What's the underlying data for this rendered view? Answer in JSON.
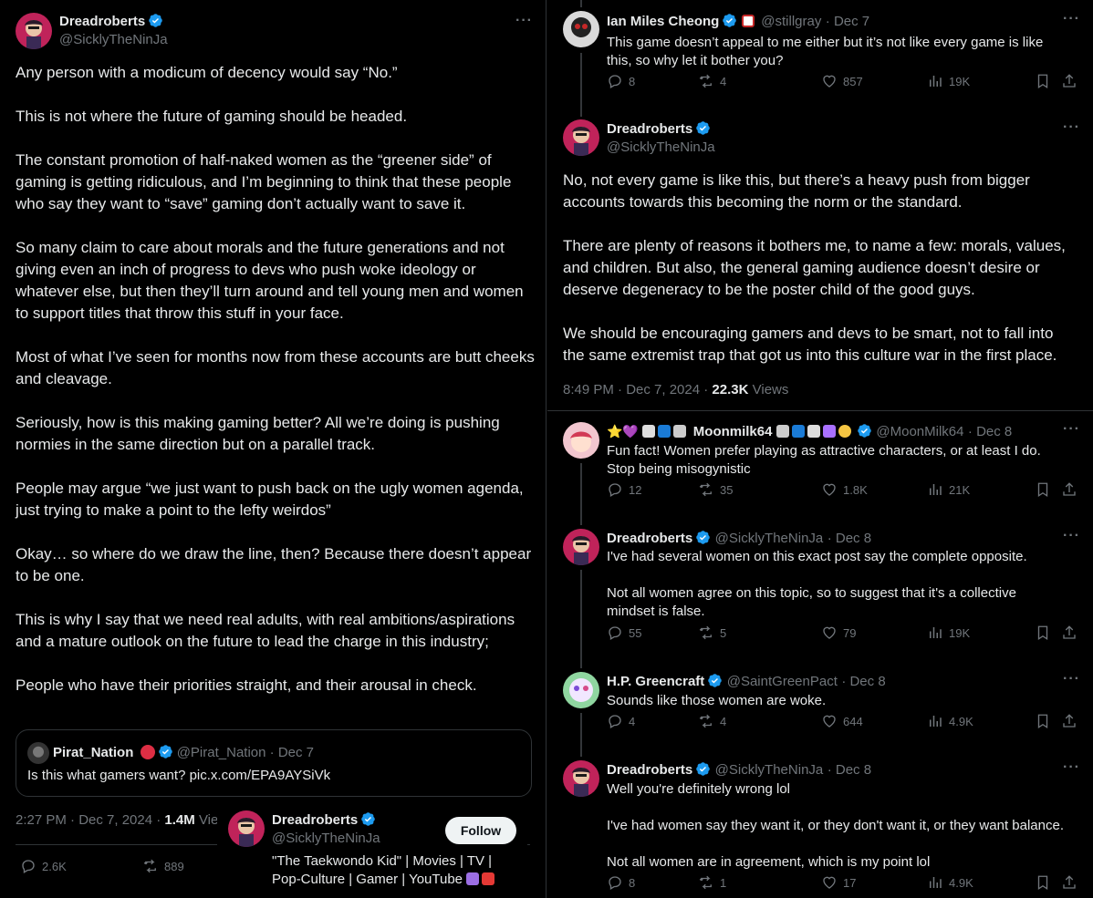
{
  "main_post": {
    "author_name": "Dreadroberts",
    "author_handle": "@SicklyTheNinJa",
    "paragraphs": [
      "Any person with a modicum of decency would say “No.”",
      "This is not where the future of gaming should be headed.",
      "The constant promotion of half-naked women as the “greener side” of gaming is getting ridiculous, and I’m beginning to think that these people who say they want to “save” gaming don’t actually want to save it.",
      "So many claim to care about morals and the future generations and not giving even an inch of progress to devs who push woke ideology or whatever else, but then they’ll turn around and tell young men and women to support titles that throw this stuff in your face.",
      "Most of what I’ve seen for months now from these accounts are butt cheeks and cleavage.",
      "Seriously, how is this making gaming better? All we’re doing is pushing normies in the same direction but on a parallel track.",
      "People may argue “we just want to push back on the ugly women agenda, just trying to make a point to the lefty weirdos”",
      "Okay… so where do we draw the line, then? Because there doesn’t appear to be one.",
      "This is why I say that we need real adults, with real ambitions/aspirations and a mature outlook on the future to lead the charge in this industry;",
      "People who have their priorities straight, and their arousal in check."
    ],
    "quote": {
      "name": "Pirat_Nation",
      "handle": "@Pirat_Nation",
      "date": "Dec 7",
      "text": "Is this what gamers want? pic.x.com/EPA9AYSiVk"
    },
    "timestamp": "2:27 PM · Dec 7, 2024 ·",
    "views_count": "1.4M",
    "views_label": "View",
    "replies": "2.6K",
    "reposts": "889"
  },
  "hovercard": {
    "name": "Dreadroberts",
    "handle": "@SicklyTheNinJa",
    "follow_label": "Follow",
    "bio_line1": "\"The Taekwondo Kid\" | Movies | TV |",
    "bio_line2": "Pop-Culture | Gamer | YouTube"
  },
  "right_thread": {
    "reply1": {
      "name": "Ian Miles Cheong",
      "handle": "@stillgray",
      "date": "· Dec 7",
      "lines": [
        "This game doesn’t appeal to me either but it’s not like every game is like",
        "this, so why let it bother you?"
      ],
      "replies": "8",
      "reposts": "4",
      "likes": "857",
      "views": "19K"
    },
    "focused": {
      "name": "Dreadroberts",
      "handle": "@SicklyTheNinJa",
      "paragraphs": [
        [
          "No, not every game is like this, but there’s a heavy push from bigger",
          "accounts towards this becoming the norm or the standard."
        ],
        [
          "There are plenty of reasons it bothers me, to name a few: morals, values,",
          "and children. But also, the general gaming audience doesn’t desire or",
          "deserve degeneracy to be the poster child of the good guys."
        ],
        [
          "We should be encouraging gamers and devs to be smart, not to fall into",
          "the same extremist trap that got us into this culture war in the first place."
        ]
      ],
      "timestamp": "8:49 PM · Dec 7, 2024 ·",
      "views_count": "22.3K",
      "views_label": "Views"
    },
    "reply2": {
      "name_prefix": "⭐💜",
      "name": "Moonmilk64",
      "handle": "@MoonMilk64",
      "date": "· Dec 8",
      "lines": [
        "Fun fact! Women prefer playing as attractive characters, or at least I do.",
        "Stop being misogynistic"
      ],
      "replies": "12",
      "reposts": "35",
      "likes": "1.8K",
      "views": "21K"
    },
    "reply3": {
      "name": "Dreadroberts",
      "handle": "@SicklyTheNinJa",
      "date": "· Dec 8",
      "lines": [
        "I've had several women on this exact post say the complete opposite.",
        "",
        "Not all women agree on this topic, so to suggest that it's a collective",
        "mindset is false."
      ],
      "replies": "55",
      "reposts": "5",
      "likes": "79",
      "views": "19K"
    },
    "reply4": {
      "name": "H.P. Greencraft",
      "handle": "@SaintGreenPact",
      "date": "· Dec 8",
      "lines": [
        "Sounds like those women are woke."
      ],
      "replies": "4",
      "reposts": "4",
      "likes": "644",
      "views": "4.9K"
    },
    "reply5": {
      "name": "Dreadroberts",
      "handle": "@SicklyTheNinJa",
      "date": "· Dec 8",
      "lines": [
        "Well you're definitely wrong lol",
        "",
        "I've had women say they want it, or they don't want it, or they want balance.",
        "",
        "Not all women are in agreement, which is my point lol"
      ],
      "replies": "8",
      "reposts": "1",
      "likes": "17",
      "views": "4.9K"
    }
  },
  "colors": {
    "verified": "#1d9bf0",
    "muted": "#71767b",
    "text": "#e7e9ea",
    "border": "#2f3336"
  }
}
